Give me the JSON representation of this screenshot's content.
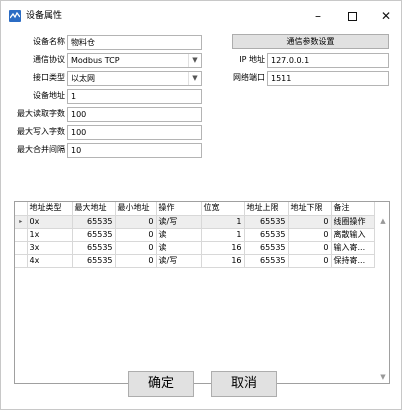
{
  "window": {
    "title": "设备属性",
    "minimize_glyph": "–",
    "close_glyph": "✕"
  },
  "form": {
    "device_name": {
      "label": "设备名称",
      "value": "物料仓"
    },
    "protocol": {
      "label": "通信协议",
      "value": "Modbus TCP"
    },
    "interface_type": {
      "label": "接口类型",
      "value": "以太网"
    },
    "device_address": {
      "label": "设备地址",
      "value": "1"
    },
    "max_read_bytes": {
      "label": "最大读取字数",
      "value": "100"
    },
    "max_write_bytes": {
      "label": "最大写入字数",
      "value": "100"
    },
    "max_merge_interval": {
      "label": "最大合并间隔",
      "value": "10"
    },
    "comm_settings_button": "通信参数设置",
    "ip_address": {
      "label": "IP 地址",
      "value": "127.0.0.1"
    },
    "network_port": {
      "label": "网络端口",
      "value": "1511"
    }
  },
  "grid": {
    "columns": [
      "地址类型",
      "最大地址",
      "最小地址",
      "操作",
      "位宽",
      "地址上限",
      "地址下限",
      "备注"
    ],
    "rows": [
      [
        "0x",
        "65535",
        "0",
        "读/写",
        "1",
        "65535",
        "0",
        "线圈操作"
      ],
      [
        "1x",
        "65535",
        "0",
        "读",
        "1",
        "65535",
        "0",
        "离散输入"
      ],
      [
        "3x",
        "65535",
        "0",
        "读",
        "16",
        "65535",
        "0",
        "输入寄..."
      ],
      [
        "4x",
        "65535",
        "0",
        "读/写",
        "16",
        "65535",
        "0",
        "保持寄..."
      ]
    ],
    "current_row_marker": "▸"
  },
  "buttons": {
    "ok": "确定",
    "cancel": "取消"
  }
}
